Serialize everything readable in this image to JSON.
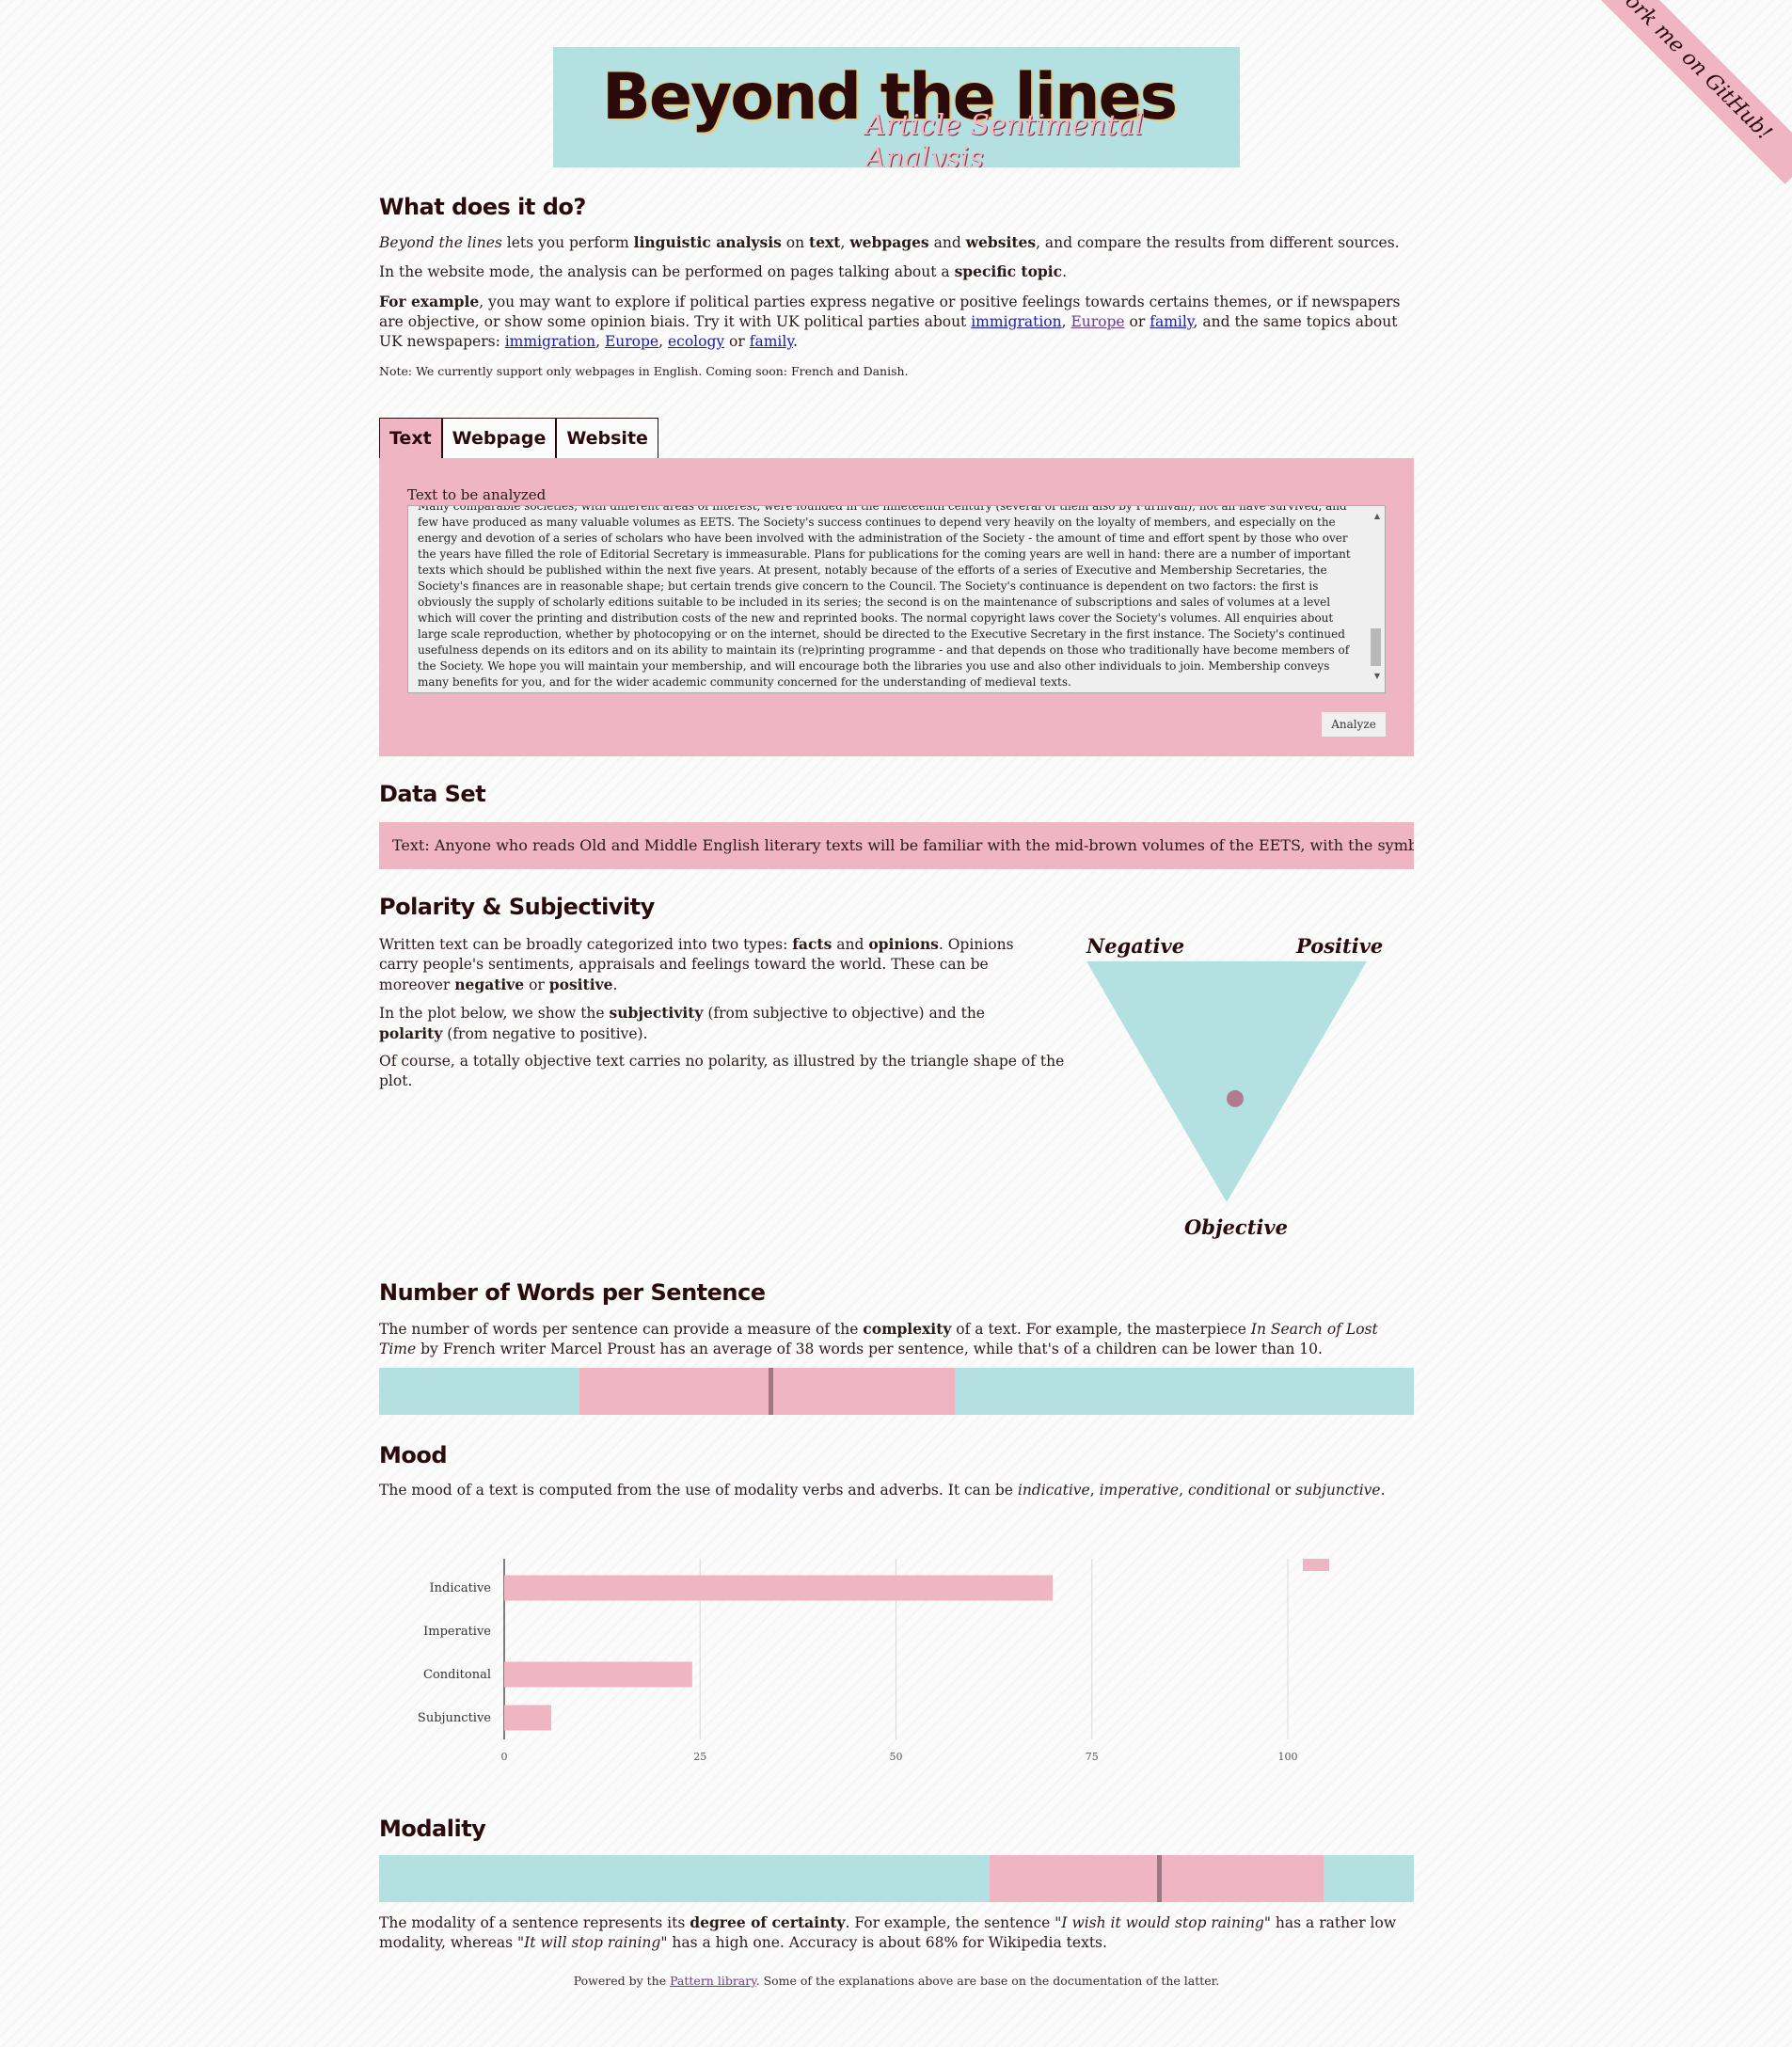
{
  "header": {
    "title": "Beyond the lines",
    "subtitle": "Article Sentimental Analysis",
    "ribbon": "Fork me on GitHub!"
  },
  "intro": {
    "heading": "What does it do?",
    "p1": {
      "em": "Beyond the lines",
      "a": " lets you perform ",
      "b1": "linguistic analysis",
      "c": " on ",
      "b2": "text",
      "d": ", ",
      "b3": "webpages",
      "e": " and ",
      "b4": "websites",
      "f": ", and compare the results from different sources."
    },
    "p2": {
      "a": "In the website mode, the analysis can be performed on pages talking about a ",
      "b": "specific topic",
      "c": "."
    },
    "p3": {
      "b": "For example",
      "a": ", you may want to explore if political parties express negative or positive feelings towards certains themes, or if newspapers are objective, or show some opinion biais. Try it with UK political parties about ",
      "l1": "immigration",
      "s1": ", ",
      "l2": "Europe",
      "s2": " or ",
      "l3": "family",
      "s3": ", and the same topics about UK newspapers: ",
      "l4": "immigration",
      "s4": ", ",
      "l5": "Europe",
      "s5": ", ",
      "l6": "ecology",
      "s6": " or ",
      "l7": "family",
      "s7": "."
    },
    "note": "Note: We currently support only webpages in English. Coming soon: French and Danish."
  },
  "tabs": [
    "Text",
    "Webpage",
    "Website"
  ],
  "form": {
    "label": "Text to be analyzed",
    "textarea_value": "Many comparable societies, with different areas of interest, were founded in the nineteenth century (several of them also by Furnivall), not all have survived, and few have produced as many valuable volumes as EETS. The Society's success continues to depend very heavily on the loyalty of members, and especially on the energy and devotion of a series of scholars who have been involved with the administration of the Society - the amount of time and effort spent by those who over the years have filled the role of Editorial Secretary is immeasurable. Plans for publications for the coming years are well in hand: there are a number of important texts which should be published within the next five years. At present, notably because of the efforts of a series of Executive and Membership Secretaries, the Society's finances are in reasonable shape; but certain trends give concern to the Council. The Society's continuance is dependent on two factors: the first is obviously the supply of scholarly editions suitable to be included in its series; the second is on the maintenance of subscriptions and sales of volumes at a level which will cover the printing and distribution costs of the new and reprinted books. The normal copyright laws cover the Society's volumes. All enquiries about large scale reproduction, whether by photocopying or on the internet, should be directed to the Executive Secretary in the first instance. The Society's continued usefulness depends on its editors and on its ability to maintain its (re)printing programme - and that depends on those who traditionally have become members of the Society. We hope you will maintain your membership, and will encourage both the libraries you use and also other individuals to join. Membership conveys many benefits for you, and for the wider academic community concerned for the understanding of medieval texts.",
    "button": "Analyze"
  },
  "dataset": {
    "heading": "Data Set",
    "entry": "Text: Anyone who reads Old and Middle English literary texts will be familiar with the mid-brown volumes of the EETS, with the symbol of Alfred's jewel"
  },
  "polarity": {
    "heading": "Polarity & Subjectivity",
    "p1": {
      "a": "Written text can be broadly categorized into two types: ",
      "b1": "facts",
      "c": " and ",
      "b2": "opinions",
      "d": ". Opinions carry people's sentiments, appraisals and feelings toward the world. These can be moreover ",
      "b3": "negative",
      "e": " or ",
      "b4": "positive",
      "f": "."
    },
    "p2": {
      "a": "In the plot below, we show the ",
      "b1": "subjectivity",
      "c": " (from subjective to objective) and the ",
      "b2": "polarity",
      "d": " (from negative to positive)."
    },
    "p3": "Of course, a totally objective text carries no polarity, as illustred by the triangle shape of the plot.",
    "labels": {
      "negative": "Negative",
      "positive": "Positive",
      "objective": "Objective"
    },
    "point": {
      "polarity": 0.14,
      "objectivity": 0.57
    },
    "colors": {
      "triangle": "#b3e0e0",
      "point": "#b07b8b"
    }
  },
  "words": {
    "heading": "Number of Words per Sentence",
    "p": {
      "a": "The number of words per sentence can provide a measure of the ",
      "b": "complexity",
      "c": " of a text. For example, the masterpiece ",
      "em": "In Search of Lost Time",
      "d": " by French writer Marcel Proust has an average of 38 words per sentence, while that's of a children can be lower than 10."
    },
    "range_start": 0.194,
    "range_end": 0.556,
    "marker": 0.376
  },
  "mood": {
    "heading": "Mood",
    "p": {
      "a": "The mood of a text is computed from the use of modality verbs and adverbs. It can be ",
      "e1": "indicative",
      "s1": ", ",
      "e2": "imperative",
      "s2": ", ",
      "e3": "conditional",
      "s3": " or ",
      "e4": "subjunctive",
      "s4": "."
    }
  },
  "chart_data": {
    "type": "bar",
    "orientation": "horizontal",
    "categories": [
      "Indicative",
      "Imperative",
      "Conditonal",
      "Subjunctive"
    ],
    "values": [
      70,
      0,
      24,
      6
    ],
    "xticks": [
      "0",
      "25",
      "50",
      "75",
      "100"
    ],
    "xlim": [
      0,
      100
    ],
    "grid": true,
    "legend": "top-right",
    "color": "#efb5c2"
  },
  "modality": {
    "heading": "Modality",
    "range_start": 0.59,
    "range_end": 0.913,
    "marker": 0.752,
    "p": {
      "a": "The modality of a sentence represents its ",
      "b": "degree of certainty",
      "c": ". For example, the sentence \"",
      "e1": "I wish it would stop raining",
      "d": "\" has a rather low modality, whereas \"",
      "e2": "It will stop raining",
      "f": "\" has a high one. Accuracy is about 68% for Wikipedia texts."
    }
  },
  "footer": {
    "a": "Powered by the ",
    "link": "Pattern library",
    "b": ". Some of the explanations above are base on the documentation of the latter."
  }
}
